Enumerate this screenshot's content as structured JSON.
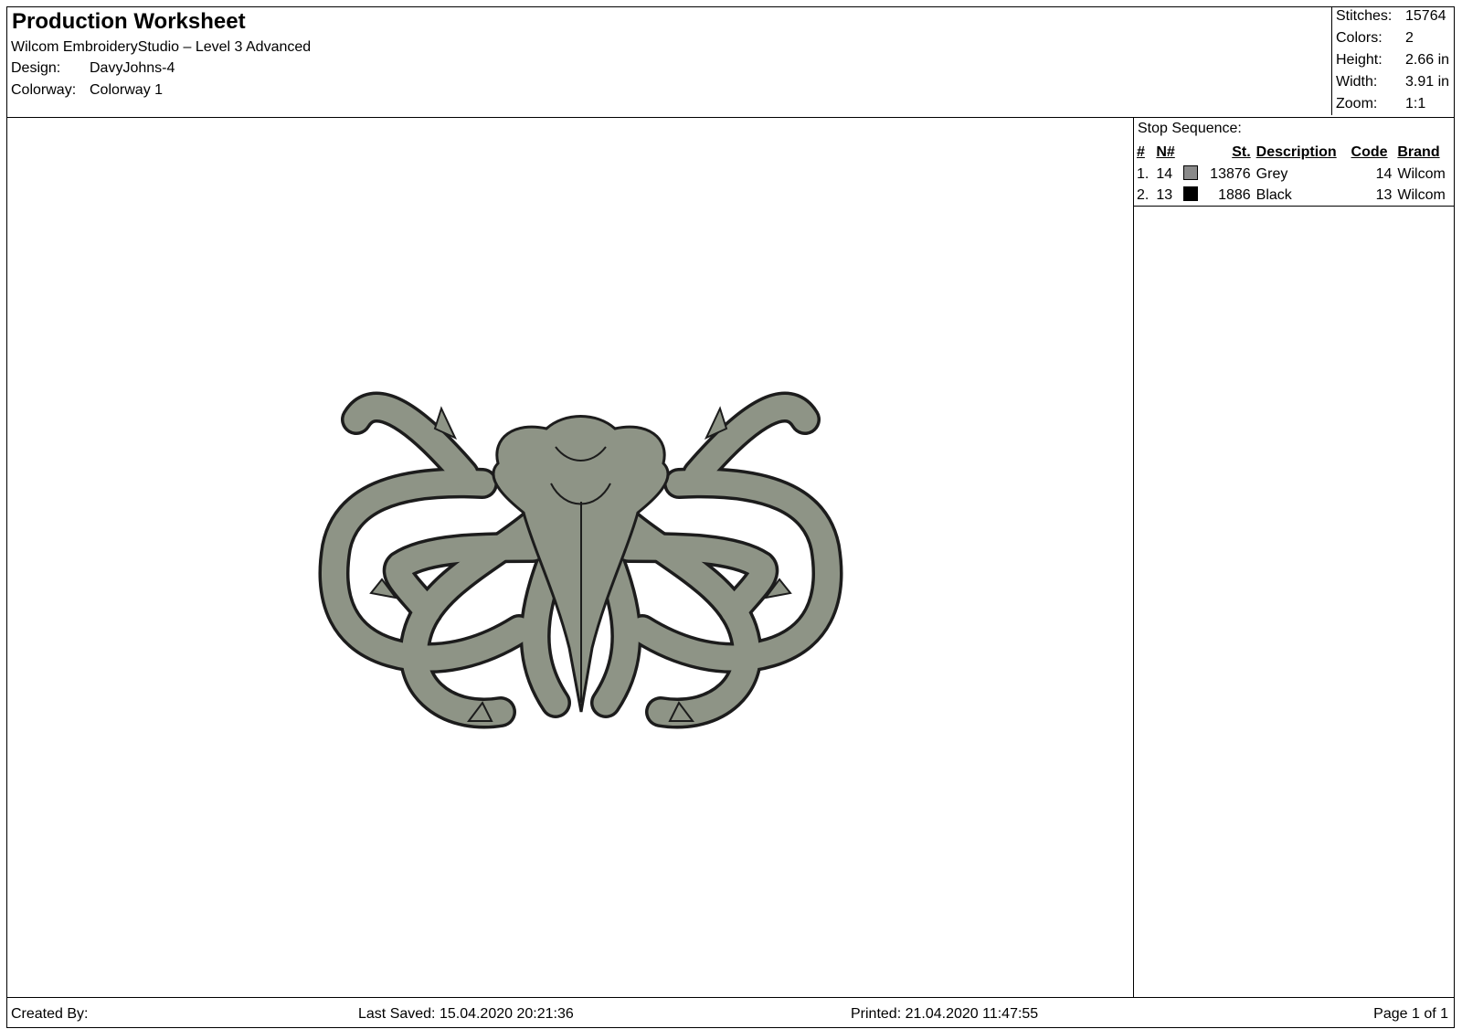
{
  "header": {
    "title": "Production Worksheet",
    "software": "Wilcom EmbroideryStudio – Level 3 Advanced",
    "design_label": "Design:",
    "design_value": "DavyJohns-4",
    "colorway_label": "Colorway:",
    "colorway_value": "Colorway 1"
  },
  "stats": {
    "stitches_label": "Stitches:",
    "stitches_value": "15764",
    "colors_label": "Colors:",
    "colors_value": "2",
    "height_label": "Height:",
    "height_value": "2.66 in",
    "width_label": "Width:",
    "width_value": "3.91 in",
    "zoom_label": "Zoom:",
    "zoom_value": "1:1"
  },
  "stop_sequence": {
    "title": "Stop Sequence:",
    "columns": [
      "#",
      "N#",
      "St.",
      "Description",
      "Code",
      "Brand"
    ],
    "rows": [
      {
        "idx": "1.",
        "n": "14",
        "color": "#8a8a8a",
        "st": "13876",
        "desc": "Grey",
        "code": "14",
        "brand": "Wilcom"
      },
      {
        "idx": "2.",
        "n": "13",
        "color": "#000000",
        "st": "1886",
        "desc": "Black",
        "code": "13",
        "brand": "Wilcom"
      }
    ]
  },
  "design_colors": {
    "fill": "#8e9486",
    "outline": "#1c1c1c"
  },
  "footer": {
    "created_by": "Created By:",
    "last_saved": "Last Saved: 15.04.2020 20:21:36",
    "printed": "Printed: 21.04.2020 11:47:55",
    "page": "Page 1 of 1"
  }
}
